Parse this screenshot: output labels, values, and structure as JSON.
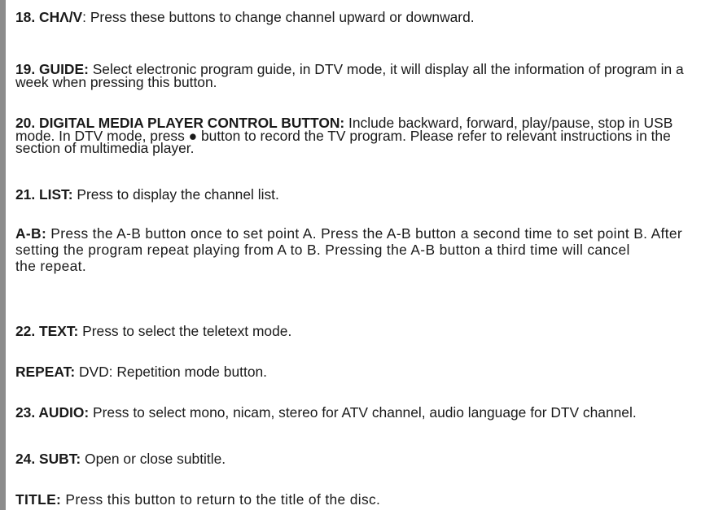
{
  "items": [
    {
      "label": "18. CHΛ/V",
      "text": ": Press these buttons to change channel upward or downward."
    },
    {
      "label": "19. GUIDE:",
      "text": " Select electronic program guide, in DTV mode, it will display all the information of program in a week when pressing this button."
    },
    {
      "label": "20. DIGITAL MEDIA PLAYER CONTROL BUTTON:",
      "text": " Include backward, forward, play/pause, stop in USB mode. In DTV mode, press ● button to record the TV program. Please refer to relevant instructions in the section of multimedia player."
    },
    {
      "label": "21. LIST:",
      "text": " Press to display the channel list."
    },
    {
      "label": "A-B:",
      "text": " Press the A-B button once to set point A. Press the A-B button a second time to set point B. After setting the program repeat playing from A to B. Pressing the A-B button a third time will cancel",
      "text2": "the repeat."
    },
    {
      "label": "22. TEXT:",
      "text": " Press to select the teletext mode."
    },
    {
      "label": "REPEAT:",
      "text": " DVD: Repetition mode button."
    },
    {
      "label": "23. AUDIO:",
      "text": " Press to select mono, nicam, stereo for ATV channel, audio language for DTV channel."
    },
    {
      "label": "24. SUBT:",
      "text": " Open or close subtitle."
    },
    {
      "label": "TITLE:",
      "text": " Press this button to return to the title of the disc."
    }
  ]
}
